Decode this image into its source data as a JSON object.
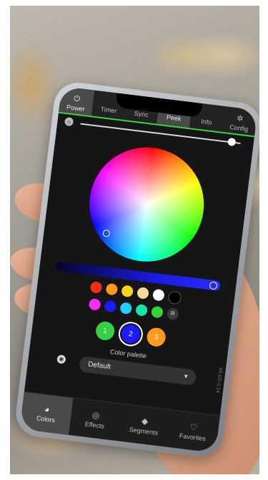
{
  "top_tabs": [
    {
      "label": "Power",
      "icon": "power-icon",
      "active": true
    },
    {
      "label": "Timer",
      "active": false
    },
    {
      "label": "Sync",
      "active": false
    },
    {
      "label": "Peek",
      "active": true
    },
    {
      "label": "Info",
      "active": false
    },
    {
      "label": "Config",
      "icon": "gear-icon",
      "active": false
    }
  ],
  "brightness": {
    "level": 0.95,
    "icon": "brightness-icon"
  },
  "color_wheel": {
    "selected_hue_color": "#2b2bff"
  },
  "swatches_row1": [
    "#ff2a1a",
    "#ff9a1a",
    "#ffd21a",
    "#ffd89a",
    "#ffffff",
    "#000000"
  ],
  "swatches_row2": [
    "#ff2aff",
    "#1a1aff",
    "#23d0ff",
    "#11e7a8",
    "#30d63a"
  ],
  "random_symbol": "R",
  "slots": [
    {
      "label": "1",
      "color": "#34d04a"
    },
    {
      "label": "2",
      "color": "#1b1bff",
      "selected": true
    },
    {
      "label": "3",
      "color": "#ff9a1a"
    }
  ],
  "palette": {
    "label": "Color palette",
    "selected": "Default",
    "icon": "palette-icon"
  },
  "version": "WLED 0.14",
  "bottom_tabs": [
    {
      "label": "Colors",
      "icon": "palette-icon",
      "active": true
    },
    {
      "label": "Effects",
      "icon": "effects-icon",
      "active": false
    },
    {
      "label": "Segments",
      "icon": "segments-icon",
      "active": false
    },
    {
      "label": "Favorites",
      "icon": "heart-icon",
      "active": false
    }
  ]
}
